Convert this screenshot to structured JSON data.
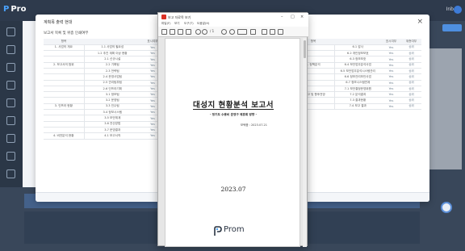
{
  "app": {
    "name": "Pro",
    "right_label": "Inb"
  },
  "modal": {
    "title": "계획목 출력 현대",
    "section_label": "보고서 목록 및 위층 인쇄여부",
    "left_headers": [
      "항목",
      "",
      "표시여부"
    ],
    "right_headers": [
      "항목",
      "",
      "표시여부",
      "위층여부"
    ],
    "left_rows": [
      {
        "group": "1. 사업의 개요",
        "item": "1.1 사업의 필요성",
        "val": "Yes"
      },
      {
        "group": "",
        "item": "1.2 추진 계획 이상 현황",
        "val": "Yes"
      },
      {
        "group": "",
        "item": "2.1 신규시설",
        "val": "Yes"
      },
      {
        "group": "2. 보고서의 범위",
        "item": "2.2 기획팀",
        "val": "Yes"
      },
      {
        "group": "",
        "item": "2.3 전략팀",
        "val": "Yes"
      },
      {
        "group": "",
        "item": "2.4 운영사업팀",
        "val": "Yes"
      },
      {
        "group": "",
        "item": "2.5 관리팀부팀",
        "val": "Yes"
      },
      {
        "group": "",
        "item": "2.6 인프라기획",
        "val": "Yes"
      },
      {
        "group": "",
        "item": "3.1 정보팀",
        "val": "Yes"
      },
      {
        "group": "",
        "item": "3.2 운영팀",
        "val": "Yes"
      },
      {
        "group": "3. 인프라 현황",
        "item": "3.3 인수팀",
        "val": "Yes"
      },
      {
        "group": "",
        "item": "3.4 정보시스템",
        "val": "Yes"
      },
      {
        "group": "",
        "item": "3.5 보안체계",
        "val": "Yes"
      },
      {
        "group": "",
        "item": "3.6 전산방법",
        "val": "Yes"
      },
      {
        "group": "",
        "item": "3.7 운영결과",
        "val": "Yes"
      },
      {
        "group": "4. 비전분석 현황",
        "item": "4.1 보고서작",
        "val": "Yes"
      }
    ],
    "right_rows": [
      {
        "group": "",
        "item": "6.1 감사",
        "val": "Yes",
        "extra": "상위"
      },
      {
        "group": "",
        "item": "6.2 개인정보보호",
        "val": "Yes",
        "extra": "상위"
      },
      {
        "group": "",
        "item": "6.3 정보보호",
        "val": "Yes",
        "extra": "상위"
      },
      {
        "group": "6. 정책분석",
        "item": "6.4 보안업무분석사업",
        "val": "Yes",
        "extra": "상위"
      },
      {
        "group": "",
        "item": "6.5 보안업무분석시스템관리",
        "val": "Yes",
        "extra": "상위"
      },
      {
        "group": "",
        "item": "6.6 정보관리보안사업",
        "val": "Yes",
        "extra": "상위"
      },
      {
        "group": "",
        "item": "6.7 정보시스템연계",
        "val": "Yes",
        "extra": "상위"
      },
      {
        "group": "",
        "item": "7.1 보안결정운영위원",
        "val": "Yes",
        "extra": "상위"
      },
      {
        "group": "7. 보고 및 향후전망",
        "item": "7.2 분석결과",
        "val": "Yes",
        "extra": "상위"
      },
      {
        "group": "",
        "item": "7.3 결과현황",
        "val": "Yes",
        "extra": "상위"
      },
      {
        "group": "",
        "item": "7.4 보고 결과",
        "val": "Yes",
        "extra": "상위"
      }
    ]
  },
  "viewer": {
    "title": "보고 자료목 보기",
    "menus": [
      "파일(F)",
      "보기",
      "도구(T)",
      "도움말(H)"
    ],
    "page_indicator": "/ 1",
    "minimize": "–",
    "maximize": "□",
    "close": "×",
    "doc": {
      "title": "대성지 현황분석 보고서",
      "subtitle": "- 정기도 수용비 운영구 체휴회 방향 -",
      "author": "보텍품 : 2023.07.21",
      "date": "2023.07",
      "logo_text": "Prom"
    }
  },
  "colors": {
    "accent": "#4aa3ff",
    "sidebar": "#2b3747",
    "logo_icon": "#2a3442"
  }
}
